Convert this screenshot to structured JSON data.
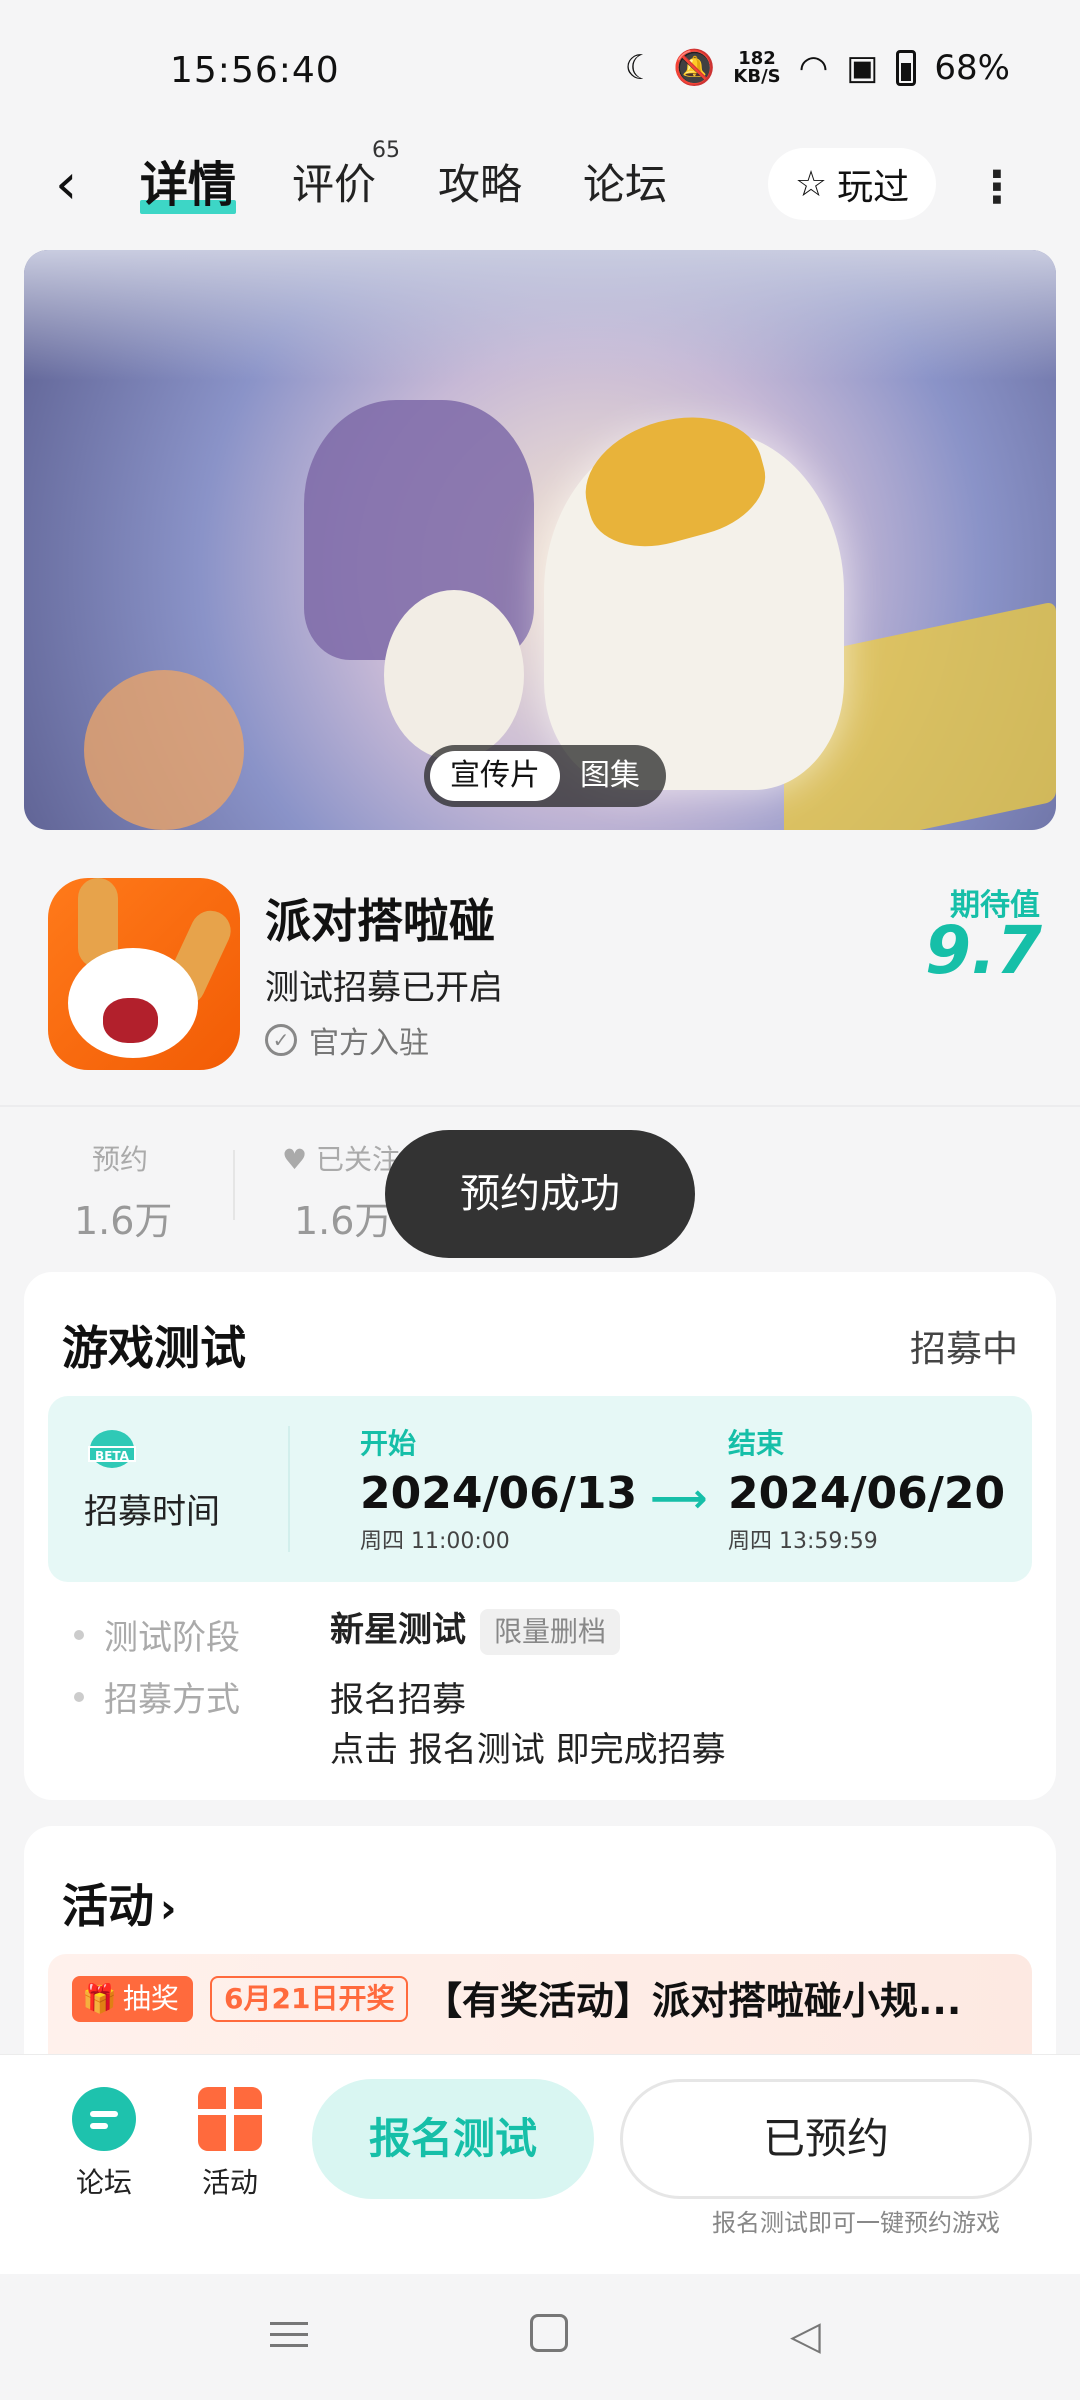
{
  "status_bar": {
    "time": "15:56:40",
    "net_speed": "182",
    "net_unit": "KB/S",
    "battery": "68%"
  },
  "nav": {
    "tabs": [
      {
        "label": "详情"
      },
      {
        "label": "评价"
      },
      {
        "label": "攻略"
      },
      {
        "label": "论坛"
      }
    ],
    "review_count": "65",
    "played_label": "玩过"
  },
  "media": {
    "tabs": [
      "宣传片",
      "图集"
    ]
  },
  "game": {
    "name": "派对搭啦碰",
    "subtitle": "测试招募已开启",
    "official": "官方入驻",
    "expect_label": "期待值",
    "expect_score": "9.7"
  },
  "stats": {
    "reserve_label": "预约",
    "reserve_value": "1.6万",
    "follow_label": "已关注",
    "follow_value": "1.6万"
  },
  "toast": "预约成功",
  "test_card": {
    "title": "游戏测试",
    "status": "招募中",
    "recruit_label": "招募时间",
    "start_label": "开始",
    "start_date": "2024/06/13",
    "start_day": "周四  11:00:00",
    "end_label": "结束",
    "end_date": "2024/06/20",
    "end_day": "周四  13:59:59",
    "phase_label": "测试阶段",
    "phase_value": "新星测试",
    "phase_tag": "限量删档",
    "method_label": "招募方式",
    "method_value": "报名招募",
    "method_desc": "点击 报名测试 即完成招募"
  },
  "activity": {
    "title": "活动",
    "badge": "抽奖",
    "date_badge": "6月21日开奖",
    "text": "【有奖活动】派对搭啦碰小规..."
  },
  "bottom_bar": {
    "forum_label": "论坛",
    "activity_label": "活动",
    "signup_label": "报名测试",
    "reserved_label": "已预约",
    "hint": "报名测试即可一键预约游戏"
  },
  "colors": {
    "accent": "#16bfa8",
    "orange": "#ff6a3d"
  }
}
